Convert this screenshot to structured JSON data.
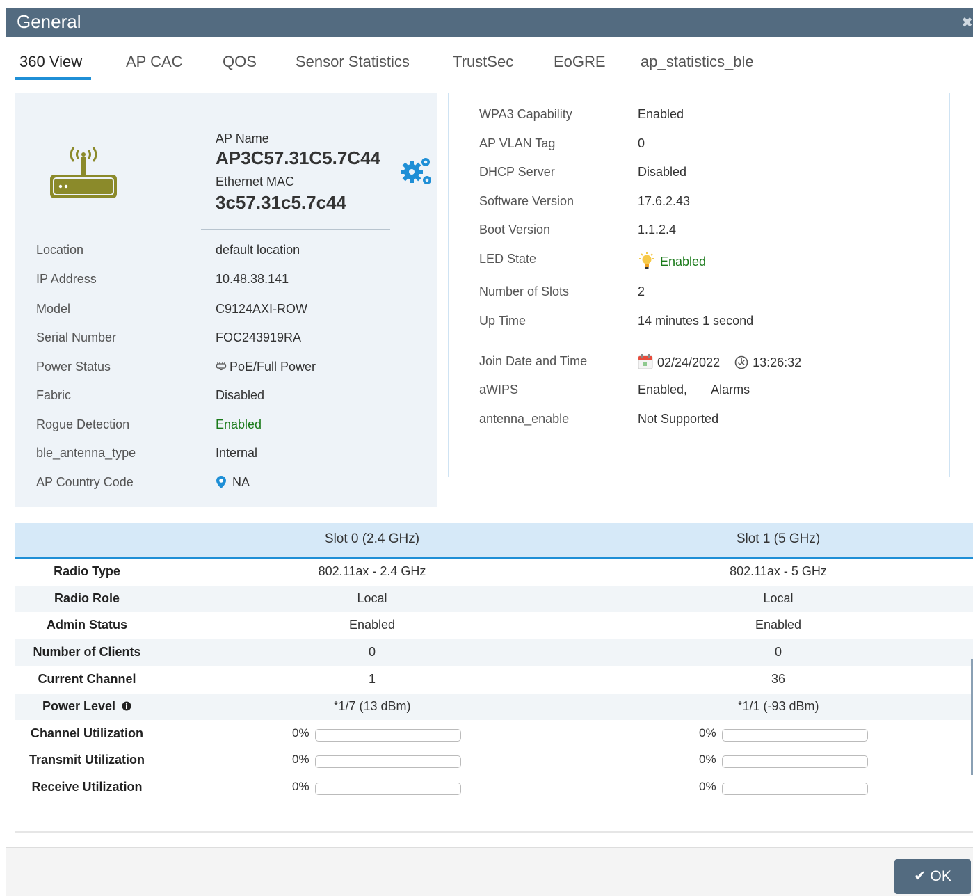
{
  "window": {
    "title": "General"
  },
  "tabs": [
    {
      "label": "360 View",
      "active": true
    },
    {
      "label": "AP CAC"
    },
    {
      "label": "QOS"
    },
    {
      "label": "Sensor Statistics"
    },
    {
      "label": "TrustSec"
    },
    {
      "label": "EoGRE"
    },
    {
      "label": "ap_statistics_ble"
    }
  ],
  "ap": {
    "name_label": "AP Name",
    "name": "AP3C57.31C5.7C44",
    "mac_label": "Ethernet MAC",
    "mac": "3c57.31c5.7c44",
    "icon": "access-point-icon",
    "settings_icon": "gear-icon"
  },
  "left_details": [
    {
      "key": "Location",
      "value": "default location"
    },
    {
      "key": "IP Address",
      "value": "10.48.38.141"
    },
    {
      "key": "Model",
      "value": "C9124AXI-ROW"
    },
    {
      "key": "Serial Number",
      "value": "FOC243919RA"
    },
    {
      "key": "Power Status",
      "value": "PoE/Full Power",
      "icon": "plug-icon"
    },
    {
      "key": "Fabric",
      "value": "Disabled"
    },
    {
      "key": "Rogue Detection",
      "value": "Enabled",
      "color": "#1a7a1a"
    },
    {
      "key": "ble_antenna_type",
      "value": "Internal"
    },
    {
      "key": "AP Country Code",
      "value": "NA",
      "icon": "location-pin-icon"
    }
  ],
  "right_details": [
    {
      "key": "WPA3 Capability",
      "value": "Enabled",
      "color": "#1a7a1a"
    },
    {
      "key": "AP VLAN Tag",
      "value": "0"
    },
    {
      "key": "DHCP Server",
      "value": "Disabled"
    },
    {
      "key": "Software Version",
      "value": "17.6.2.43"
    },
    {
      "key": "Boot Version",
      "value": "1.1.2.4"
    },
    {
      "key": "LED State",
      "value": "Enabled",
      "icon": "lightbulb-icon",
      "color": "#1a7a1a"
    },
    {
      "key": "Number of Slots",
      "value": "2"
    },
    {
      "key": "Up Time",
      "value": "14 minutes 1 second"
    },
    {
      "key": "Join Date and Time",
      "date": "02/24/2022",
      "time": "13:26:32",
      "date_icon": "calendar-icon",
      "time_icon": "clock-icon"
    },
    {
      "key": "aWIPS",
      "value": "Enabled,",
      "extra": "Alarms"
    },
    {
      "key": "antenna_enable",
      "value": "Not Supported"
    }
  ],
  "radio_table": {
    "headers": [
      "",
      "Slot 0 (2.4 GHz)",
      "Slot 1 (5 GHz)"
    ],
    "rows": [
      {
        "label": "Radio Type",
        "slot0": "802.11ax - 2.4 GHz",
        "slot1": "802.11ax - 5 GHz"
      },
      {
        "label": "Radio Role",
        "slot0": "Local",
        "slot1": "Local"
      },
      {
        "label": "Admin Status",
        "slot0": "Enabled",
        "slot1": "Enabled"
      },
      {
        "label": "Number of Clients",
        "slot0": "0",
        "slot1": "0"
      },
      {
        "label": "Current Channel",
        "slot0": "1",
        "slot1": "36"
      },
      {
        "label": "Power Level",
        "slot0": "*1/7 (13 dBm)",
        "slot1": "*1/1 (-93 dBm)",
        "icon": "info-icon"
      }
    ],
    "utilization": [
      {
        "label": "Channel Utilization",
        "slot0": "0%",
        "slot1": "0%",
        "slot0_fraction": 0,
        "slot1_fraction": 0
      },
      {
        "label": "Transmit Utilization",
        "slot0": "0%",
        "slot1": "0%",
        "slot0_fraction": 0,
        "slot1_fraction": 0
      },
      {
        "label": "Receive Utilization",
        "slot0": "0%",
        "slot1": "0%",
        "slot0_fraction": 0,
        "slot1_fraction": 0
      }
    ]
  },
  "footer": {
    "ok_label": "OK",
    "ok_icon": "checkmark-icon"
  },
  "colors": {
    "header": "#536b80",
    "accent": "#1f8fd6",
    "enabled": "#1a7a1a",
    "device_icon": "#8b8a2a"
  }
}
